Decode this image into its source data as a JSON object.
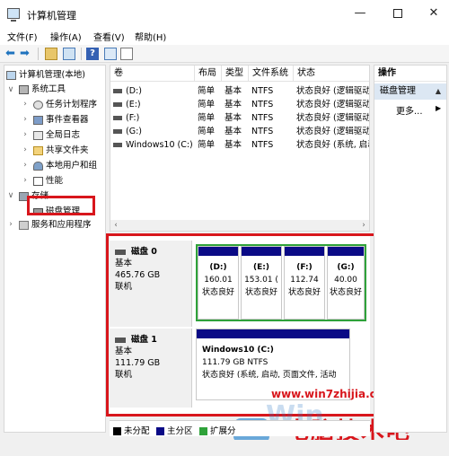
{
  "window": {
    "title": "计算机管理",
    "minimize_glyph": "—",
    "close_glyph": "✕"
  },
  "menu": [
    "文件(F)",
    "操作(A)",
    "查看(V)",
    "帮助(H)"
  ],
  "toolbar": {
    "back_glyph": "⬅",
    "forward_glyph": "➡",
    "help_glyph": "?"
  },
  "tree": {
    "expand_glyph": "∨",
    "collapse_glyph": "›",
    "items": [
      {
        "label": "计算机管理(本地)",
        "icon": "computer-icon",
        "indent": 0
      },
      {
        "label": "系统工具",
        "icon": "tools-icon",
        "indent": 1
      },
      {
        "label": "任务计划程序",
        "icon": "clock-icon",
        "indent": 2
      },
      {
        "label": "事件查看器",
        "icon": "event-viewer-icon",
        "indent": 2
      },
      {
        "label": "全局日志",
        "icon": "log-icon",
        "indent": 2
      },
      {
        "label": "共享文件夹",
        "icon": "shared-folder-icon",
        "indent": 2
      },
      {
        "label": "本地用户和组",
        "icon": "users-icon",
        "indent": 2
      },
      {
        "label": "性能",
        "icon": "performance-icon",
        "indent": 2
      },
      {
        "label": "存储",
        "icon": "storage-icon",
        "indent": 1
      },
      {
        "label": "磁盘管理",
        "icon": "disk-management-icon",
        "indent": 2,
        "selected": true
      },
      {
        "label": "服务和应用程序",
        "icon": "services-icon",
        "indent": 1
      }
    ]
  },
  "volume_list": {
    "columns": [
      "卷",
      "布局",
      "类型",
      "文件系统",
      "状态"
    ],
    "rows": [
      {
        "volume": "(D:)",
        "layout": "简单",
        "type": "基本",
        "fs": "NTFS",
        "status": "状态良好 (逻辑驱动"
      },
      {
        "volume": "(E:)",
        "layout": "简单",
        "type": "基本",
        "fs": "NTFS",
        "status": "状态良好 (逻辑驱动"
      },
      {
        "volume": "(F:)",
        "layout": "简单",
        "type": "基本",
        "fs": "NTFS",
        "status": "状态良好 (逻辑驱动"
      },
      {
        "volume": "(G:)",
        "layout": "简单",
        "type": "基本",
        "fs": "NTFS",
        "status": "状态良好 (逻辑驱动"
      },
      {
        "volume": "Windows10 (C:)",
        "layout": "简单",
        "type": "基本",
        "fs": "NTFS",
        "status": "状态良好 (系统, 启动"
      }
    ],
    "scroll_left": "‹",
    "scroll_right": "›"
  },
  "disks": [
    {
      "name": "磁盘 0",
      "type": "基本",
      "size": "465.76 GB",
      "status": "联机",
      "partitions": [
        {
          "letter": "(D:)",
          "size": "160.01",
          "status": "状态良好"
        },
        {
          "letter": "(E:)",
          "size": "153.01 (",
          "status": "状态良好"
        },
        {
          "letter": "(F:)",
          "size": "112.74",
          "status": "状态良好"
        },
        {
          "letter": "(G:)",
          "size": "40.00",
          "status": "状态良好"
        }
      ]
    },
    {
      "name": "磁盘 1",
      "type": "基本",
      "size": "111.79 GB",
      "status": "联机",
      "partitions": [
        {
          "letter": "Windows10  (C:)",
          "size": "111.79 GB NTFS",
          "status": "状态良好 (系统, 启动, 页面文件, 活动"
        }
      ]
    }
  ],
  "legend": [
    {
      "label": "未分配",
      "color": "#000000"
    },
    {
      "label": "主分区",
      "color": "#0a0a86"
    },
    {
      "label": "扩展分",
      "color": "#2fa23a"
    }
  ],
  "actions": {
    "title": "操作",
    "group": "磁盘管理",
    "group_caret": "▲",
    "more": "更多...",
    "more_arrow": "▶"
  },
  "watermark": {
    "url": "www.win7zhijia.cn",
    "brand": "电脑技术吧",
    "logo_text": "Win"
  },
  "colors": {
    "highlight_red": "#d8161c",
    "primary_partition": "#0a0a86",
    "extended_partition": "#2fa23a"
  }
}
